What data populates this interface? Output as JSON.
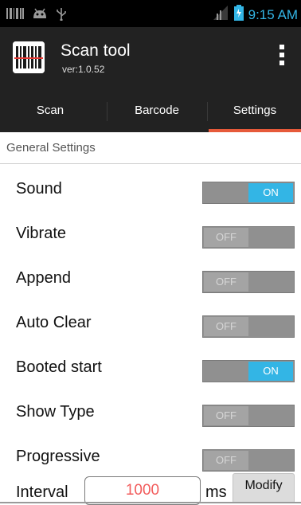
{
  "status_bar": {
    "time": "9:15 AM",
    "icons": [
      "barcode-icon",
      "android-icon",
      "usb-icon",
      "signal-icon",
      "battery-icon"
    ],
    "accent_color": "#33b5e5"
  },
  "app": {
    "title": "Scan tool",
    "version": "ver:1.0.52",
    "icon": "barcode-app-icon"
  },
  "tabs": [
    {
      "label": "Scan",
      "active": false
    },
    {
      "label": "Barcode",
      "active": false
    },
    {
      "label": "Settings",
      "active": true
    }
  ],
  "section": {
    "title": "General Settings"
  },
  "settings": [
    {
      "label": "Sound",
      "state": "ON"
    },
    {
      "label": "Vibrate",
      "state": "OFF"
    },
    {
      "label": "Append",
      "state": "OFF"
    },
    {
      "label": "Auto Clear",
      "state": "OFF"
    },
    {
      "label": "Booted start",
      "state": "ON"
    },
    {
      "label": "Show Type",
      "state": "OFF"
    },
    {
      "label": "Progressive",
      "state": "OFF"
    }
  ],
  "interval": {
    "label": "Interval",
    "value": "1000",
    "unit": "ms",
    "button_label": "Modify"
  },
  "colors": {
    "toggle_on": "#33b5e5",
    "tab_indicator": "#e65a3a",
    "interval_value": "#f25c5c"
  }
}
